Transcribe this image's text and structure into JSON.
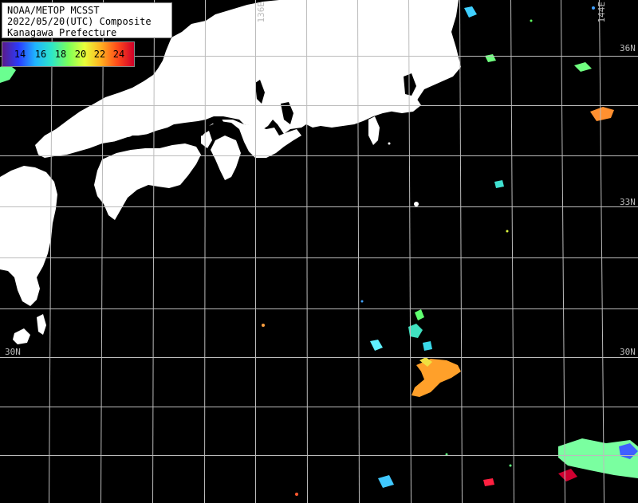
{
  "title": {
    "line1": "NOAA/METOP MCSST",
    "line2": "2022/05/20(UTC) Composite",
    "line3": "Kanagawa Prefecture"
  },
  "legend": {
    "ticks": [
      "14",
      "16",
      "18",
      "20",
      "22",
      "24"
    ],
    "colors": [
      "#5a1a8a",
      "#2a3cff",
      "#1fb4ff",
      "#2ee6c8",
      "#7aff5a",
      "#e8ff3a",
      "#ffb020",
      "#ff4a1a",
      "#d0002a"
    ]
  },
  "grid_labels": {
    "lat_right": [
      "36N",
      "33N",
      "30N"
    ],
    "lat_left": [
      "30N"
    ],
    "lon_top": [
      "136E",
      "144E"
    ]
  },
  "colors": {
    "land": "#ffffff",
    "sea_nodata": "#000000",
    "grid": "#bcbcbc"
  }
}
